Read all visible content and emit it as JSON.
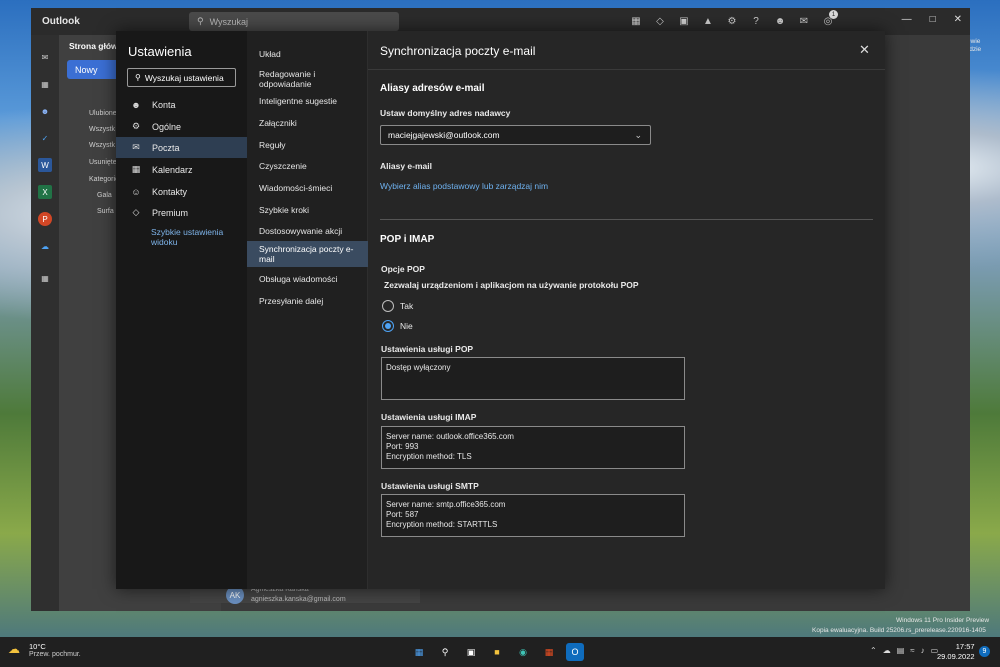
{
  "window": {
    "app_name": "Outlook",
    "search_placeholder": "Wyszukaj",
    "notification_count": "1"
  },
  "background_pane": {
    "tab_label": "Strona głów",
    "new_button": "Nowy",
    "folders": [
      "Ulubione",
      "Wszystk",
      "Wszystk",
      "Usunięte",
      "Kategorie",
      "Gala",
      "Surfa"
    ],
    "account_initials": "AK",
    "account_name": "Agnieszka Kańska",
    "account_email": "agnieszka.kanska@gmail.com"
  },
  "settings": {
    "title": "Ustawienia",
    "search_label": "Wyszukaj ustawienia",
    "categories": [
      {
        "label": "Konta",
        "icon": "person-icon"
      },
      {
        "label": "Ogólne",
        "icon": "gear-icon"
      },
      {
        "label": "Poczta",
        "icon": "mail-icon"
      },
      {
        "label": "Kalendarz",
        "icon": "calendar-icon"
      },
      {
        "label": "Kontakty",
        "icon": "contacts-icon"
      },
      {
        "label": "Premium",
        "icon": "diamond-icon"
      }
    ],
    "quick_settings": "Szybkie ustawienia widoku",
    "subcategories": [
      "Układ",
      "Redagowanie i odpowiadanie",
      "Inteligentne sugestie",
      "Załączniki",
      "Reguły",
      "Czyszczenie",
      "Wiadomości-śmieci",
      "Szybkie kroki",
      "Dostosowywanie akcji",
      "Synchronizacja poczty e-mail",
      "Obsługa wiadomości",
      "Przesyłanie dalej"
    ],
    "panel": {
      "title": "Synchronizacja poczty e-mail",
      "aliases_heading": "Aliasy adresów e-mail",
      "default_sender_label": "Ustaw domyślny adres nadawcy",
      "default_sender_value": "maciejgajewski@outlook.com",
      "aliases_label": "Aliasy e-mail",
      "aliases_link": "Wybierz alias podstawowy lub zarządzaj nim",
      "pop_imap_heading": "POP i IMAP",
      "pop_options_label": "Opcje POP",
      "pop_question": "Zezwalaj urządzeniom i aplikacjom na używanie protokołu POP",
      "radio_yes": "Tak",
      "radio_no": "Nie",
      "pop_settings_label": "Ustawienia usługi POP",
      "pop_settings_value": "Dostęp wyłączony",
      "imap_settings_label": "Ustawienia usługi IMAP",
      "imap_lines": [
        "Server name: outlook.office365.com",
        "Port: 993",
        "Encryption method: TLS"
      ],
      "smtp_settings_label": "Ustawienia usługi SMTP",
      "smtp_lines": [
        "Server name: smtp.office365.com",
        "Port: 587",
        "Encryption method: STARTTLS"
      ]
    }
  },
  "desktop": {
    "corner_text_1": "niewie",
    "corner_text_2": "zdzie",
    "watermark_1": "Windows 11 Pro Insider Preview",
    "watermark_2": "Kopia ewaluacyjna. Build 25206.rs_prerelease.220916-1405"
  },
  "taskbar": {
    "temperature": "10°C",
    "weather": "Przew. pochmur.",
    "time": "17:57",
    "date": "29.09.2022",
    "tray_badge": "9"
  }
}
